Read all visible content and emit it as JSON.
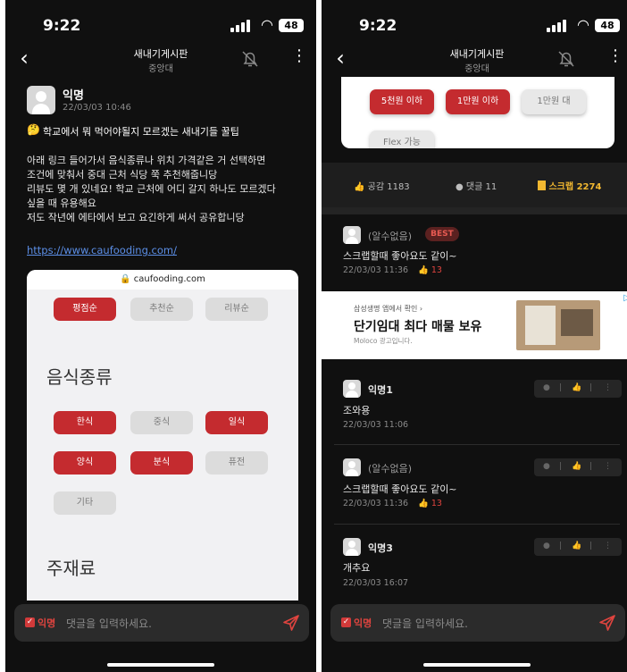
{
  "status": {
    "time": "9:22",
    "battery": "48"
  },
  "nav": {
    "title": "새내기게시판",
    "subtitle": "중앙대"
  },
  "post": {
    "author": "익명",
    "date": "22/03/03 10:46",
    "title_emoji": "🤔",
    "title": "학교에서 뭐 먹어야될지 모르겠는 새내기들 꿀팁",
    "body": [
      "아래 링크 들어가서 음식종류나 위치 가격같은 거 선택하면",
      "조건에 맞춰서 중대 근처 식당 쭉 추천해줍니당",
      "리뷰도 몇 개 있네요! 학교 근처에 어디 갈지 하나도 모르겠다",
      "싶을 때 유용해요",
      "저도 작년에 에타에서 보고 요긴하게 써서 공유합니당"
    ],
    "link": "https://www.caufooding.com/"
  },
  "embed": {
    "url": "caufooding.com",
    "sort_chips": [
      {
        "label": "평점순",
        "active": true
      },
      {
        "label": "추천순",
        "active": false
      },
      {
        "label": "리뷰순",
        "active": false
      }
    ],
    "section_food": "음식종류",
    "food_chips": [
      {
        "label": "한식",
        "active": true
      },
      {
        "label": "중식",
        "active": false
      },
      {
        "label": "일식",
        "active": true
      },
      {
        "label": "양식",
        "active": true
      },
      {
        "label": "분식",
        "active": true
      },
      {
        "label": "퓨전",
        "active": false
      },
      {
        "label": "기타",
        "active": false
      }
    ],
    "section_ingredient": "주재료"
  },
  "price_chips": [
    {
      "label": "5천원 이하",
      "active": true
    },
    {
      "label": "1만원 이하",
      "active": true
    },
    {
      "label": "1만원 대",
      "active": false
    },
    {
      "label": "Flex 가능",
      "active": false
    }
  ],
  "actions": {
    "like": "공감 1183",
    "comment": "댓글 11",
    "scrap": "스크랩 2274"
  },
  "comments": [
    {
      "author": "(알수없음)",
      "best": "BEST",
      "text": "스크랩할때 좋아요도 같이~",
      "date": "22/03/03 11:36",
      "likes": "13"
    },
    {
      "author": "익명1",
      "text": "조와용",
      "date": "22/03/03 11:06"
    },
    {
      "author": "(알수없음)",
      "text": "스크랩할때 좋아요도 같이~",
      "date": "22/03/03 11:36",
      "likes": "13"
    },
    {
      "author": "익명3",
      "text": "개추요",
      "date": "22/03/03 16:07"
    }
  ],
  "ad": {
    "source": "삼성생명 앱에서 확인 ›",
    "headline": "단기임대 최다 매물 보유",
    "disclosure": "Moloco 광고입니다."
  },
  "input": {
    "anon_label": "익명",
    "placeholder": "댓글을 입력하세요."
  },
  "colors": {
    "accent": "#c42b2f",
    "background": "#101010",
    "scrap": "#f2b830"
  }
}
